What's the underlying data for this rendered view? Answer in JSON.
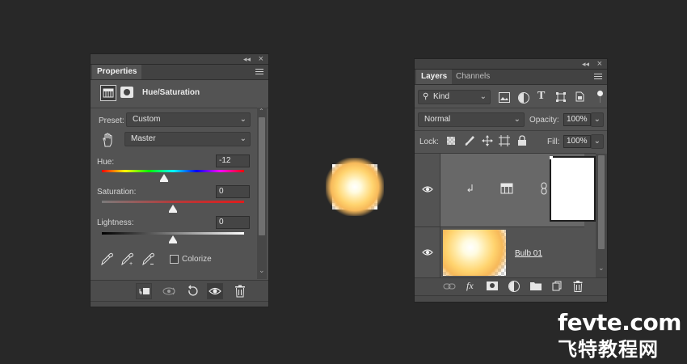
{
  "properties_panel": {
    "tab": "Properties",
    "adjustment_title": "Hue/Saturation",
    "preset_label": "Preset:",
    "preset_value": "Custom",
    "channel_value": "Master",
    "hue": {
      "label": "Hue:",
      "value": "-12"
    },
    "saturation": {
      "label": "Saturation:",
      "value": "0"
    },
    "lightness": {
      "label": "Lightness:",
      "value": "0"
    },
    "colorize_label": "Colorize"
  },
  "layers_panel": {
    "tabs": [
      "Layers",
      "Channels"
    ],
    "filter_kind": "Kind",
    "blend_mode": "Normal",
    "opacity_label": "Opacity:",
    "opacity_value": "100%",
    "lock_label": "Lock:",
    "fill_label": "Fill:",
    "fill_value": "100%",
    "layers": [
      {
        "name": ""
      },
      {
        "name": "Bulb 01"
      }
    ]
  },
  "watermark": {
    "line1": "fevte.com",
    "line2": "飞特教程网"
  },
  "colors": {
    "panel_bg": "#535353",
    "canvas_bg": "#282828",
    "selected_layer": "#686868"
  },
  "icons": [
    "collapse-icon",
    "close-icon",
    "panel-menu-icon",
    "adjustment-layer-icon",
    "mask-icon",
    "targeted-adjustment-hand-icon",
    "eyedropper-icon",
    "eyedropper-plus-icon",
    "eyedropper-minus-icon",
    "clip-to-layer-icon",
    "view-previous-icon",
    "reset-icon",
    "visibility-eye-icon",
    "delete-icon",
    "search-icon",
    "link-icon",
    "fx-icon",
    "add-mask-icon",
    "new-adjustment-icon",
    "folder-icon",
    "new-layer-icon"
  ]
}
